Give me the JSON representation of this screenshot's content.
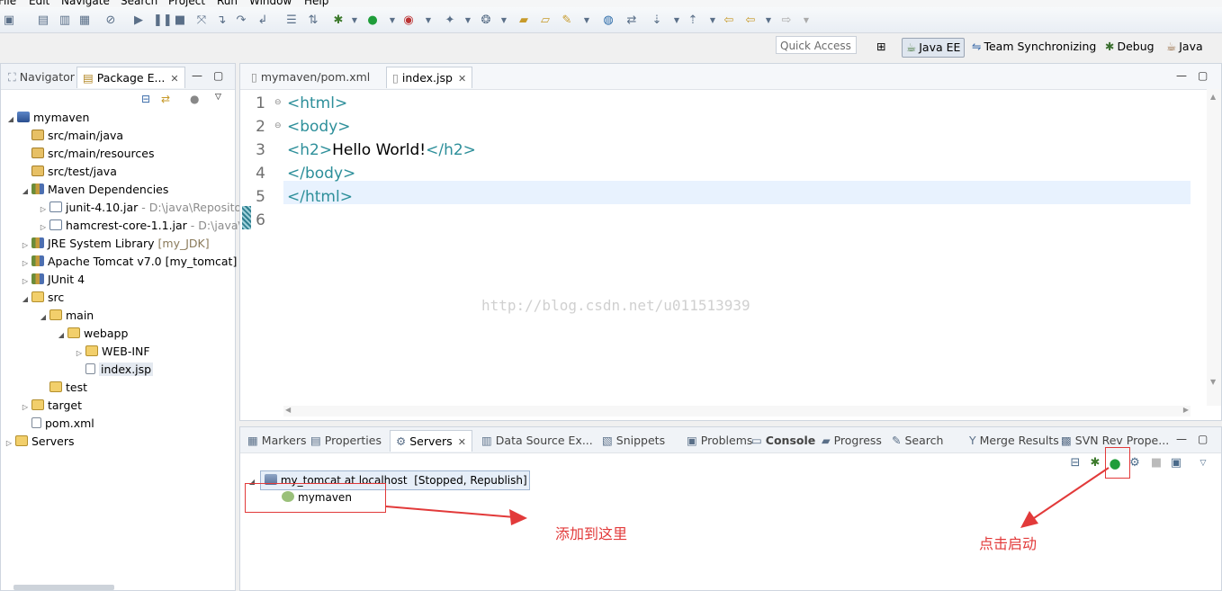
{
  "menubar": [
    "File",
    "Edit",
    "Navigate",
    "Search",
    "Project",
    "Run",
    "Window",
    "Help"
  ],
  "quick_access": "Quick Access",
  "perspectives": [
    {
      "label": "Java EE",
      "icon": "java-ee-icon"
    },
    {
      "label": "Team Synchronizing",
      "icon": "team-sync-icon"
    },
    {
      "label": "Debug",
      "icon": "bug-icon"
    },
    {
      "label": "Java",
      "icon": "java-icon"
    }
  ],
  "left_panel": {
    "tabs": [
      {
        "label": "Navigator"
      },
      {
        "label": "Package E..."
      }
    ],
    "tree": [
      {
        "label": "mymaven",
        "icon": "project-icon",
        "twisty": "open"
      },
      {
        "label": "src/main/java",
        "icon": "package-folder-icon"
      },
      {
        "label": "src/main/resources",
        "icon": "package-folder-icon"
      },
      {
        "label": "src/test/java",
        "icon": "package-folder-icon"
      },
      {
        "label": "Maven Dependencies",
        "icon": "library-icon",
        "twisty": "open"
      },
      {
        "label": "junit-4.10.jar",
        "suffix": " - D:\\java\\Reposito",
        "icon": "jar-icon",
        "twisty": "closed"
      },
      {
        "label": "hamcrest-core-1.1.jar",
        "suffix": " - D:\\java\\",
        "icon": "jar-icon",
        "twisty": "closed"
      },
      {
        "label": "JRE System Library",
        "suffix": " [my_JDK]",
        "icon": "library-icon",
        "twisty": "closed"
      },
      {
        "label": "Apache Tomcat v7.0 [my_tomcat]",
        "icon": "library-icon",
        "twisty": "closed"
      },
      {
        "label": "JUnit 4",
        "icon": "library-icon",
        "twisty": "closed"
      },
      {
        "label": "src",
        "icon": "folder-icon",
        "twisty": "open"
      },
      {
        "label": "main",
        "icon": "folder-icon",
        "twisty": "open"
      },
      {
        "label": "webapp",
        "icon": "folder-icon",
        "twisty": "open"
      },
      {
        "label": "WEB-INF",
        "icon": "folder-icon",
        "twisty": "closed"
      },
      {
        "label": "index.jsp",
        "icon": "file-icon"
      },
      {
        "label": "test",
        "icon": "folder-icon"
      },
      {
        "label": "target",
        "icon": "folder-icon",
        "twisty": "closed"
      },
      {
        "label": "pom.xml",
        "icon": "xml-file-icon"
      },
      {
        "label": "Servers",
        "icon": "folder-icon",
        "twisty": "closed"
      }
    ]
  },
  "editor": {
    "tabs": [
      {
        "label": "mymaven/pom.xml"
      },
      {
        "label": "index.jsp"
      }
    ],
    "lines": [
      {
        "num": "1",
        "parts": [
          {
            "t": "<html>",
            "k": "tag"
          }
        ]
      },
      {
        "num": "2",
        "parts": [
          {
            "t": "<body>",
            "k": "tag"
          }
        ]
      },
      {
        "num": "3",
        "parts": [
          {
            "t": "<h2>",
            "k": "tag"
          },
          {
            "t": "Hello World!",
            "k": "txt"
          },
          {
            "t": "</h2>",
            "k": "tag"
          }
        ]
      },
      {
        "num": "4",
        "parts": [
          {
            "t": "</body>",
            "k": "tag"
          }
        ]
      },
      {
        "num": "5",
        "parts": [
          {
            "t": "</html>",
            "k": "tag"
          }
        ]
      },
      {
        "num": "6",
        "parts": []
      }
    ]
  },
  "bottom_panel": {
    "tabs": [
      {
        "label": "Markers"
      },
      {
        "label": "Properties"
      },
      {
        "label": "Servers"
      },
      {
        "label": "Data Source Ex..."
      },
      {
        "label": "Snippets"
      },
      {
        "label": "Problems"
      },
      {
        "label": "Console"
      },
      {
        "label": "Progress"
      },
      {
        "label": "Search"
      },
      {
        "label": "Merge Results"
      },
      {
        "label": "SVN Rev Prope..."
      }
    ],
    "server": {
      "name": "my_tomcat at localhost",
      "status": "[Stopped, Republish]"
    },
    "module": "mymaven"
  },
  "annotations": {
    "add_here": "添加到这里",
    "click_start": "点击启动"
  },
  "watermark": "http://blog.csdn.net/u011513939"
}
